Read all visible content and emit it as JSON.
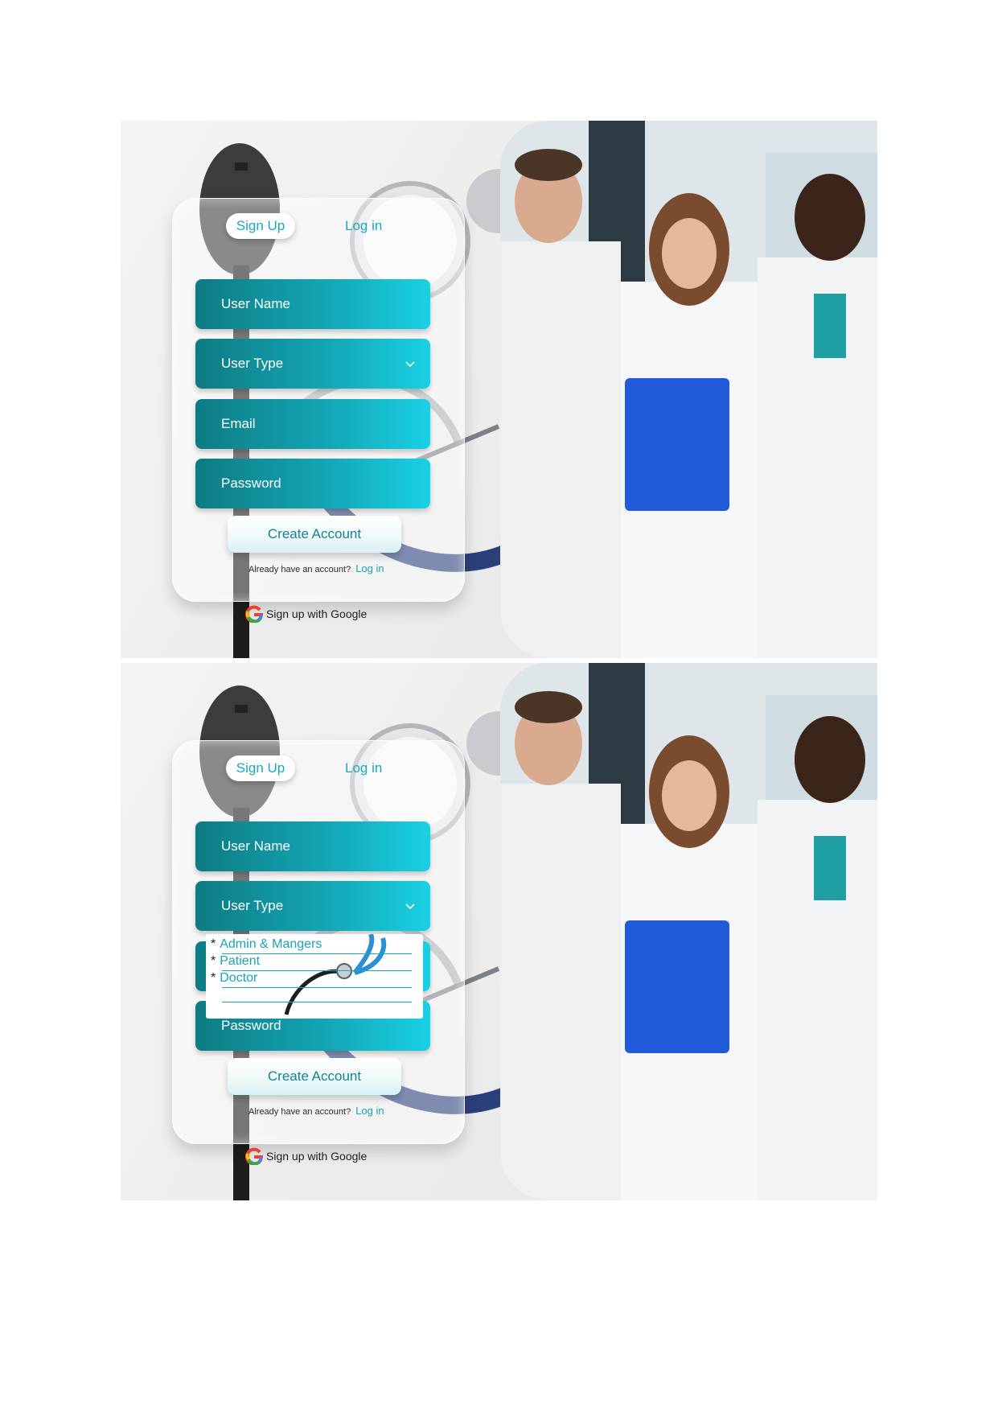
{
  "screens": [
    {
      "tabs": {
        "signup": "Sign Up",
        "login": "Log in"
      },
      "fields": {
        "username": "User Name",
        "usertype": "User Type",
        "email": "Email",
        "password": "Password"
      },
      "create_button": "Create Account",
      "already_text": "Already have an account?",
      "already_link": "Log in",
      "google_text": "Sign up with Google",
      "dropdown_open": false
    },
    {
      "tabs": {
        "signup": "Sign Up",
        "login": "Log in"
      },
      "fields": {
        "username": "User Name",
        "usertype": "User Type",
        "password": "Password"
      },
      "create_button": "Create Account",
      "already_text": "Already have an account?",
      "already_link": "Log in",
      "google_text": "Sign up with Google",
      "dropdown_open": true,
      "user_type_options": [
        "Admin & Mangers",
        "Patient",
        "Doctor"
      ]
    }
  ],
  "colors": {
    "field_gradient_start": "#0e7b83",
    "field_gradient_end": "#19d1e4",
    "accent": "#1aa8bf",
    "folder_blue": "#1f5bd8"
  }
}
